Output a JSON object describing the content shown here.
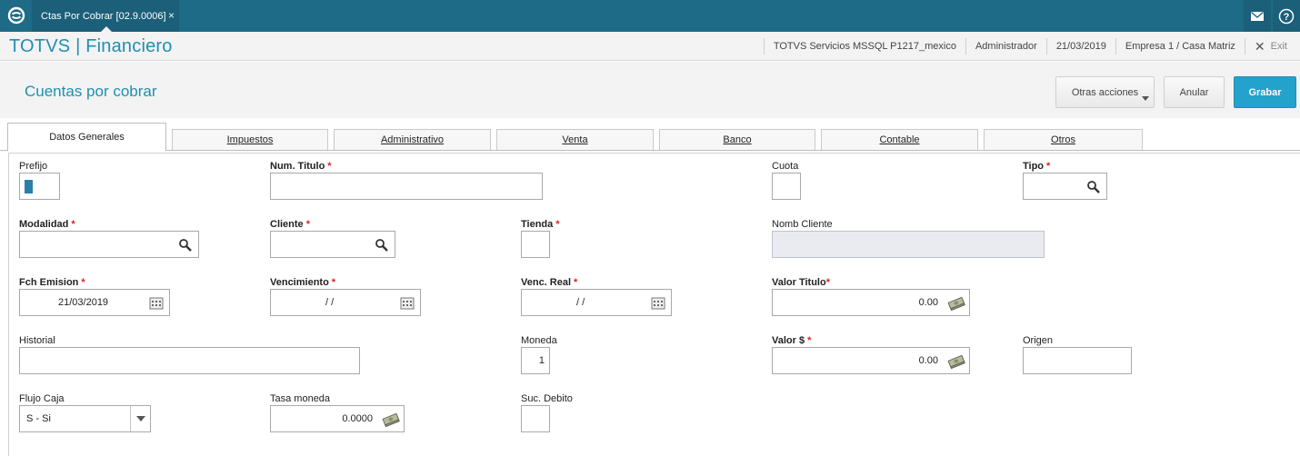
{
  "topbar": {
    "tab_title": "Ctas Por Cobrar [02.9.0006]",
    "tab_close": "×",
    "icons": [
      "totvs-logo-icon",
      "mail-icon",
      "help-icon"
    ],
    "help_glyph": "?"
  },
  "header": {
    "brand": "TOTVS | Financiero",
    "server": "TOTVS Servicios MSSQL P1217_mexico",
    "user": "Administrador",
    "date": "21/03/2019",
    "company": "Empresa 1 / Casa Matriz",
    "exit_label": "Exit",
    "exit_glyph": "✕"
  },
  "titlebar": {
    "title": "Cuentas por cobrar",
    "other_actions": "Otras acciones",
    "cancel": "Anular",
    "save": "Grabar"
  },
  "tabs": [
    "Datos Generales",
    "Impuestos",
    "Administrativo",
    "Venta",
    "Banco",
    "Contable",
    "Otros"
  ],
  "form": {
    "required_mark": "*",
    "prefijo": {
      "label": "Prefijo",
      "value": ""
    },
    "num_titulo": {
      "label": "Num. Titulo",
      "value": ""
    },
    "cuota": {
      "label": "Cuota",
      "value": ""
    },
    "tipo": {
      "label": "Tipo",
      "value": ""
    },
    "modalidad": {
      "label": "Modalidad",
      "value": ""
    },
    "cliente": {
      "label": "Cliente",
      "value": ""
    },
    "tienda": {
      "label": "Tienda",
      "value": ""
    },
    "nomb_cliente": {
      "label": "Nomb Cliente",
      "value": ""
    },
    "fch_emision": {
      "label": "Fch Emision",
      "value": "21/03/2019"
    },
    "vencimiento": {
      "label": "Vencimiento",
      "value": "/ /"
    },
    "venc_real": {
      "label": "Venc. Real",
      "value": "/ /"
    },
    "valor_titulo": {
      "label": "Valor Titulo",
      "value": "0.00"
    },
    "historial": {
      "label": "Historial",
      "value": ""
    },
    "moneda": {
      "label": "Moneda",
      "value": "1"
    },
    "valor_dolar": {
      "label": "Valor $",
      "value": "0.00"
    },
    "origen": {
      "label": "Origen",
      "value": ""
    },
    "flujo_caja": {
      "label": "Flujo Caja",
      "value": "S - Si"
    },
    "tasa_moneda": {
      "label": "Tasa moneda",
      "value": "0.0000"
    },
    "suc_debito": {
      "label": "Suc. Debito",
      "value": ""
    }
  },
  "colors": {
    "topbar": "#1d6b86",
    "accent": "#1f8fb2",
    "primary_button": "#23a2cb",
    "required": "#e02020"
  }
}
